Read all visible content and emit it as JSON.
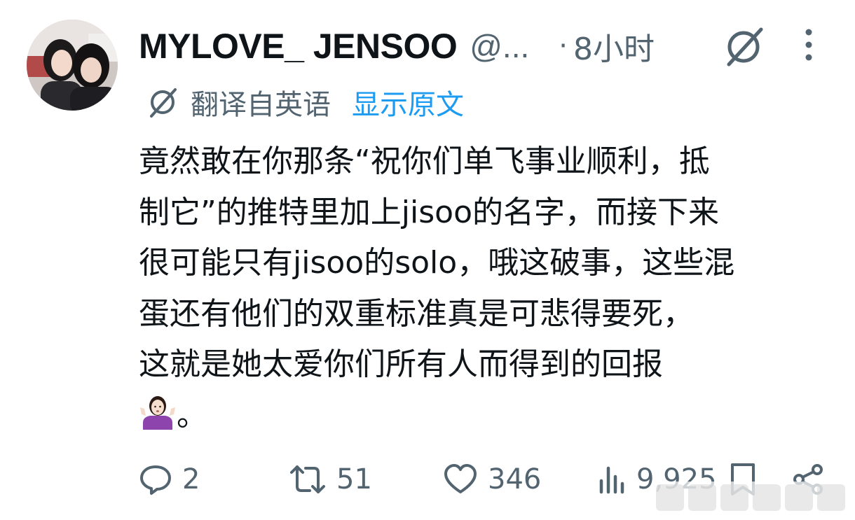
{
  "author": {
    "display_name": "MYLOVE_ JENSOO",
    "handle": "@...",
    "dot": "·",
    "time": "8小时"
  },
  "icons": {
    "grok": "grok-icon",
    "more": "more-icon",
    "reply": "reply-icon",
    "repost": "repost-icon",
    "like": "like-icon",
    "views": "views-icon",
    "bookmark": "bookmark-icon",
    "share": "share-icon",
    "emoji": "person-shrugging-emoji"
  },
  "translation": {
    "label": "翻译自英语",
    "show_original": "显示原文"
  },
  "post": {
    "lines": [
      "竟然敢在你那条“祝你们单飞事业顺利，抵",
      "制它”的推特里加上jisoo的名字，而接下来",
      "很可能只有jisoo的solo，哦这破事，这些混",
      "蛋还有他们的双重标准真是可悲得要死，",
      "这就是她太爱你们所有人而得到的回报"
    ],
    "tail": "。"
  },
  "actions": {
    "replies": "2",
    "reposts": "51",
    "likes": "346",
    "views": "9,925"
  },
  "colors": {
    "text": "#0f1419",
    "secondary": "#536471",
    "link": "#1d9bf0",
    "emoji_shirt": "#8e44ad"
  }
}
